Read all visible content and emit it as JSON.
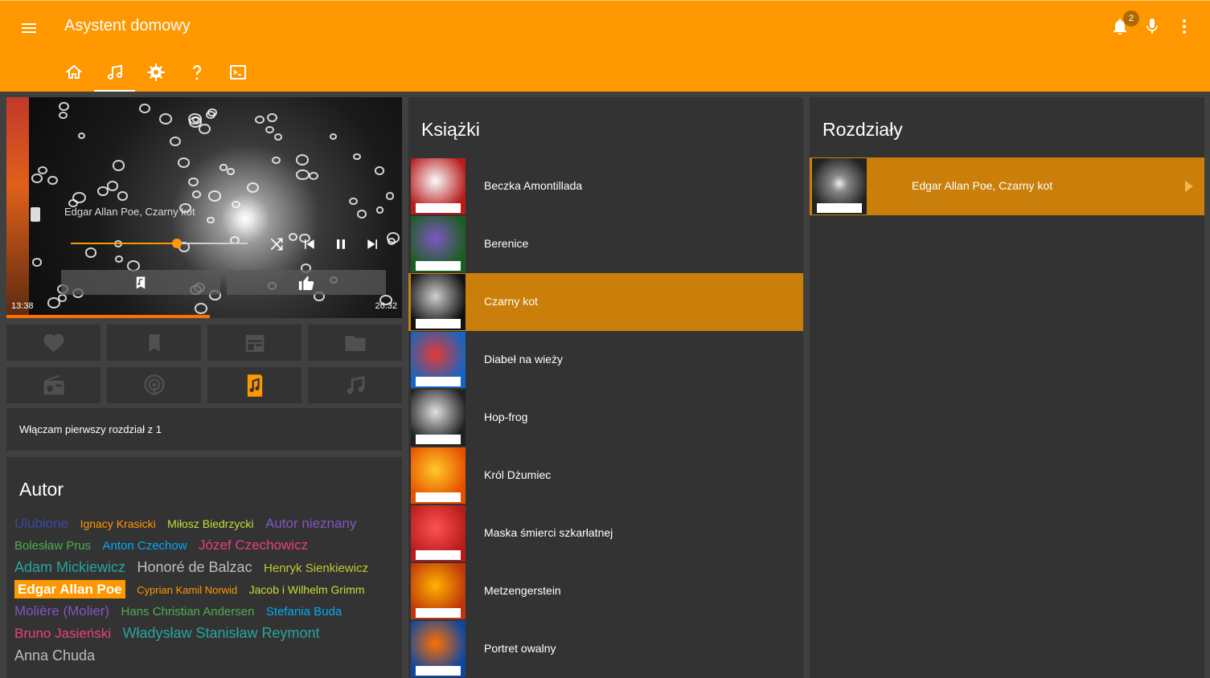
{
  "app": {
    "title": "Asystent domowy",
    "notification_count": "2"
  },
  "colors": {
    "accent": "#ff9800",
    "panel": "#333333",
    "selected": "#c97f0a"
  },
  "tabs": [
    {
      "icon": "home-icon"
    },
    {
      "icon": "music-note-icon",
      "active": true
    },
    {
      "icon": "gear-icon"
    },
    {
      "icon": "help-icon"
    },
    {
      "icon": "terminal-icon"
    }
  ],
  "player": {
    "now_playing": "Edgar Allan Poe, Czarny kot",
    "elapsed": "13:38",
    "total": "26:32",
    "slider_fraction": 0.6,
    "progress_fraction": 0.514
  },
  "source_buttons": [
    {
      "icon": "heart-icon"
    },
    {
      "icon": "bookmark-icon"
    },
    {
      "icon": "calendar-icon"
    },
    {
      "icon": "folder-icon"
    },
    {
      "icon": "radio-icon"
    },
    {
      "icon": "podcast-icon"
    },
    {
      "icon": "audiobook-icon",
      "active": true
    },
    {
      "icon": "music-icon"
    }
  ],
  "status": {
    "text": "Włączam pierwszy rozdział z 1"
  },
  "author": {
    "heading": "Autor",
    "tags": [
      {
        "name": "Ulubione",
        "color": "#3949ab",
        "size": 17
      },
      {
        "name": "Ignacy Krasicki",
        "color": "#ff9800",
        "size": 14
      },
      {
        "name": "Miłosz Biedrzycki",
        "color": "#cddc39",
        "size": 14
      },
      {
        "name": "Autor nieznany",
        "color": "#7e57c2",
        "size": 17
      },
      {
        "name": "Bolesław Prus",
        "color": "#4caf50",
        "size": 15
      },
      {
        "name": "Anton Czechow",
        "color": "#03a9f4",
        "size": 15
      },
      {
        "name": "Józef Czechowicz",
        "color": "#ec407a",
        "size": 17
      },
      {
        "name": "Adam Mickiewicz",
        "color": "#26a69a",
        "size": 18
      },
      {
        "name": "Honoré de Balzac",
        "color": "#bdbdbd",
        "size": 18
      },
      {
        "name": "Henryk Sienkiewicz",
        "color": "#c0ca33",
        "size": 15
      },
      {
        "name": "Edgar Allan Poe",
        "color": "#ffffff",
        "size": 17,
        "active": true
      },
      {
        "name": "Cyprian Kamil Norwid",
        "color": "#ff9800",
        "size": 13
      },
      {
        "name": "Jacob i Wilhelm Grimm",
        "color": "#cddc39",
        "size": 14
      },
      {
        "name": "Molière (Molier)",
        "color": "#7e57c2",
        "size": 17
      },
      {
        "name": "Hans Christian Andersen",
        "color": "#4caf50",
        "size": 15
      },
      {
        "name": "Stefania Buda",
        "color": "#03a9f4",
        "size": 15
      },
      {
        "name": "Bruno Jasieński",
        "color": "#ec407a",
        "size": 17
      },
      {
        "name": "Władysław Stanisław Reymont",
        "color": "#26a69a",
        "size": 18
      },
      {
        "name": "Anna Chuda",
        "color": "#bdbdbd",
        "size": 18
      }
    ]
  },
  "books": {
    "heading": "Książki",
    "items": [
      {
        "title": "Beczka Amontillada",
        "c1": "#b71c1c",
        "c2": "#fafafa"
      },
      {
        "title": "Berenice",
        "c1": "#1b5e20",
        "c2": "#7e57c2"
      },
      {
        "title": "Czarny kot",
        "c1": "#111111",
        "c2": "#cfcfcf",
        "selected": true
      },
      {
        "title": "Diabeł na wieży",
        "c1": "#1565c0",
        "c2": "#e53935"
      },
      {
        "title": "Hop-frog",
        "c1": "#212121",
        "c2": "#e0e0e0"
      },
      {
        "title": "Król Dżumiec",
        "c1": "#e65100",
        "c2": "#ffca28"
      },
      {
        "title": "Maska śmierci szkarłatnej",
        "c1": "#b71c1c",
        "c2": "#ff5252"
      },
      {
        "title": "Metzengerstein",
        "c1": "#bf360c",
        "c2": "#ffb300"
      },
      {
        "title": "Portret owalny",
        "c1": "#0d47a1",
        "c2": "#ff6f00"
      }
    ]
  },
  "chapters": {
    "heading": "Rozdziały",
    "items": [
      {
        "title": "Edgar Allan Poe, Czarny kot"
      }
    ]
  }
}
